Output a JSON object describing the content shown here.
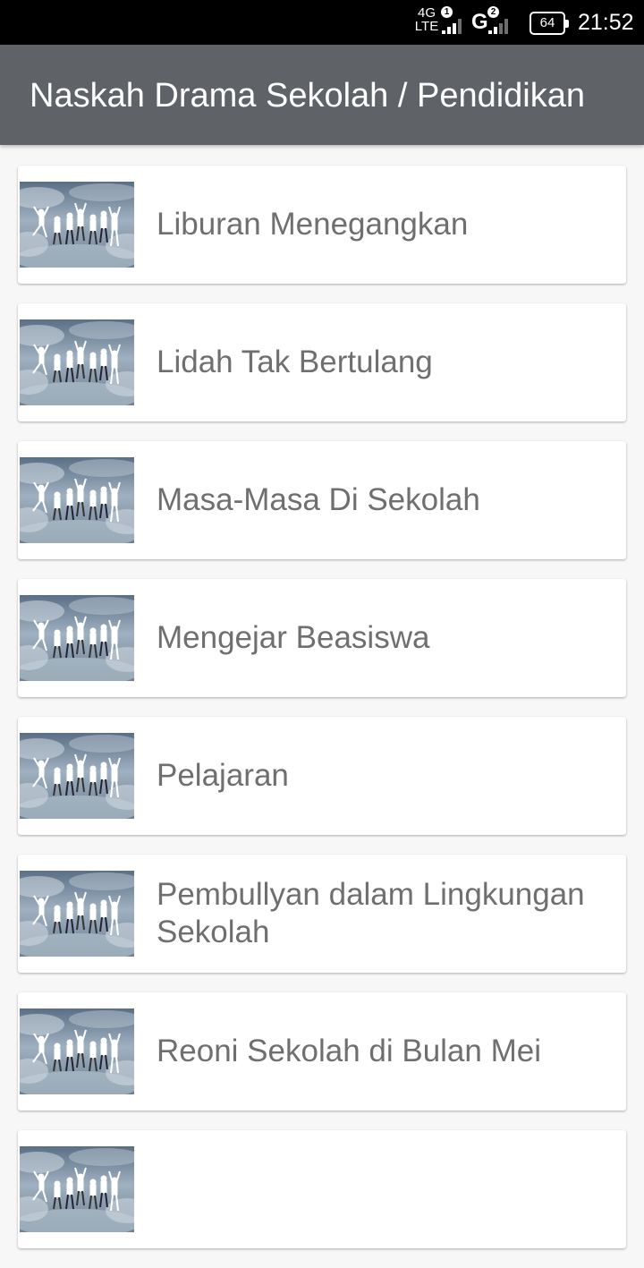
{
  "status_bar": {
    "network1": "4G",
    "network1_sub": "LTE",
    "sim1": "1",
    "network2": "G",
    "sim2": "2",
    "battery": "64",
    "time": "21:52"
  },
  "app_bar": {
    "title": "Naskah Drama Sekolah / Pendidikan"
  },
  "list": {
    "items": [
      {
        "title": "Liburan Menegangkan",
        "icon": "group-photo-thumbnail"
      },
      {
        "title": "Lidah Tak Bertulang",
        "icon": "group-photo-thumbnail"
      },
      {
        "title": "Masa-Masa Di Sekolah",
        "icon": "group-photo-thumbnail"
      },
      {
        "title": "Mengejar Beasiswa",
        "icon": "group-photo-thumbnail"
      },
      {
        "title": "Pelajaran",
        "icon": "group-photo-thumbnail"
      },
      {
        "title": "Pembullyan dalam Lingkungan Sekolah",
        "icon": "group-photo-thumbnail"
      },
      {
        "title": "Reoni Sekolah di Bulan Mei",
        "icon": "group-photo-thumbnail"
      },
      {
        "title": "",
        "icon": "group-photo-thumbnail"
      }
    ]
  },
  "colors": {
    "app_bar": "#5f6368",
    "background": "#f7f7f7",
    "card": "#ffffff",
    "text": "#6f6f6f"
  }
}
